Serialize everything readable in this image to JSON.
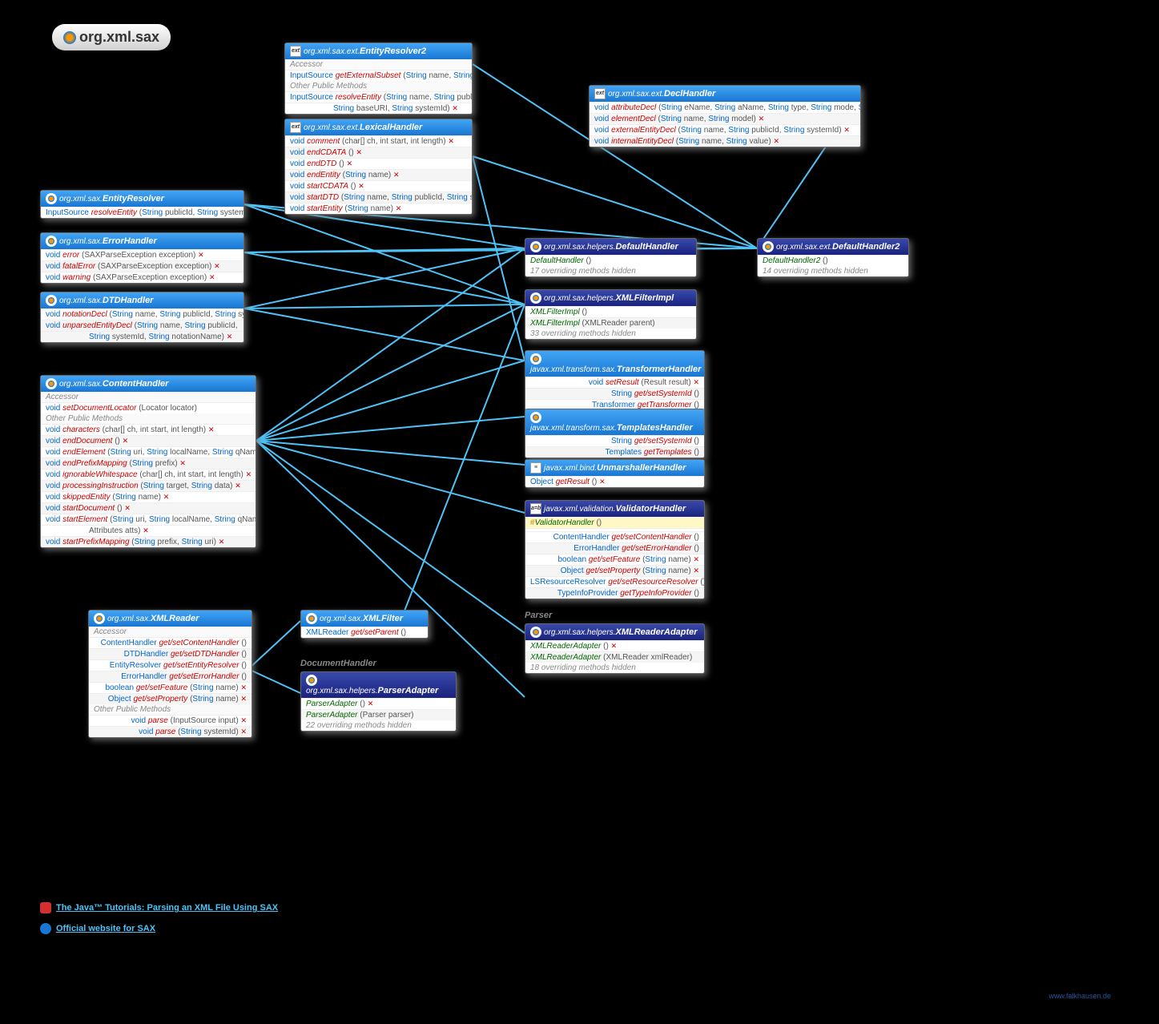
{
  "title": "org.xml.sax",
  "boxes": {
    "entityResolver2": {
      "pkg": "org.xml.sax.ext.",
      "cls": "EntityResolver2",
      "sections": [
        {
          "label": "Accessor",
          "rows": [
            {
              "ret": "InputSource",
              "meth": "getExternalSubset",
              "params": "(String name, String baseURI)",
              "throws": true
            }
          ]
        },
        {
          "label": "Other Public Methods",
          "rows": [
            {
              "ret": "InputSource",
              "meth": "resolveEntity",
              "params": "(String name, String publicId,",
              "cont": "String baseURI, String systemId)",
              "throws": true
            }
          ]
        }
      ]
    },
    "declHandler": {
      "pkg": "org.xml.sax.ext.",
      "cls": "DeclHandler",
      "rows": [
        {
          "ret": "void",
          "meth": "attributeDecl",
          "params": "(String eName, String aName, String type, String mode, String value)",
          "throws": true
        },
        {
          "ret": "void",
          "meth": "elementDecl",
          "params": "(String name, String model)",
          "throws": true
        },
        {
          "ret": "void",
          "meth": "externalEntityDecl",
          "params": "(String name, String publicId, String systemId)",
          "throws": true
        },
        {
          "ret": "void",
          "meth": "internalEntityDecl",
          "params": "(String name, String value)",
          "throws": true
        }
      ]
    },
    "lexicalHandler": {
      "pkg": "org.xml.sax.ext.",
      "cls": "LexicalHandler",
      "rows": [
        {
          "ret": "void",
          "meth": "comment",
          "params": "(char[] ch, int start, int length)",
          "throws": true
        },
        {
          "ret": "void",
          "meth": "endCDATA",
          "params": "()",
          "throws": true
        },
        {
          "ret": "void",
          "meth": "endDTD",
          "params": "()",
          "throws": true
        },
        {
          "ret": "void",
          "meth": "endEntity",
          "params": "(String name)",
          "throws": true
        },
        {
          "ret": "void",
          "meth": "startCDATA",
          "params": "()",
          "throws": true
        },
        {
          "ret": "void",
          "meth": "startDTD",
          "params": "(String name, String publicId, String systemId)",
          "throws": true
        },
        {
          "ret": "void",
          "meth": "startEntity",
          "params": "(String name)",
          "throws": true
        }
      ]
    },
    "entityResolver": {
      "pkg": "org.xml.sax.",
      "cls": "EntityResolver",
      "rows": [
        {
          "ret": "InputSource",
          "meth": "resolveEntity",
          "params": "(String publicId, String systemId)",
          "throws": true
        }
      ]
    },
    "errorHandler": {
      "pkg": "org.xml.sax.",
      "cls": "ErrorHandler",
      "rows": [
        {
          "ret": "void",
          "meth": "error",
          "params": "(SAXParseException exception)",
          "throws": true
        },
        {
          "ret": "void",
          "meth": "fatalError",
          "params": "(SAXParseException exception)",
          "throws": true
        },
        {
          "ret": "void",
          "meth": "warning",
          "params": "(SAXParseException exception)",
          "throws": true
        }
      ]
    },
    "dtdHandler": {
      "pkg": "org.xml.sax.",
      "cls": "DTDHandler",
      "rows": [
        {
          "ret": "void",
          "meth": "notationDecl",
          "params": "(String name, String publicId, String systemId)",
          "throws": true
        },
        {
          "ret": "void",
          "meth": "unparsedEntityDecl",
          "params": "(String name, String publicId,",
          "cont": "String systemId, String notationName)",
          "throws": true
        }
      ]
    },
    "contentHandler": {
      "pkg": "org.xml.sax.",
      "cls": "ContentHandler",
      "sections": [
        {
          "label": "Accessor",
          "rows": [
            {
              "ret": "void",
              "meth": "setDocumentLocator",
              "params": "(Locator locator)"
            }
          ]
        },
        {
          "label": "Other Public Methods",
          "rows": [
            {
              "ret": "void",
              "meth": "characters",
              "params": "(char[] ch, int start, int length)",
              "throws": true
            },
            {
              "ret": "void",
              "meth": "endDocument",
              "params": "()",
              "throws": true
            },
            {
              "ret": "void",
              "meth": "endElement",
              "params": "(String uri, String localName, String qName)",
              "throws": true
            },
            {
              "ret": "void",
              "meth": "endPrefixMapping",
              "params": "(String prefix)",
              "throws": true
            },
            {
              "ret": "void",
              "meth": "ignorableWhitespace",
              "params": "(char[] ch, int start, int length)",
              "throws": true
            },
            {
              "ret": "void",
              "meth": "processingInstruction",
              "params": "(String target, String data)",
              "throws": true
            },
            {
              "ret": "void",
              "meth": "skippedEntity",
              "params": "(String name)",
              "throws": true
            },
            {
              "ret": "void",
              "meth": "startDocument",
              "params": "()",
              "throws": true
            },
            {
              "ret": "void",
              "meth": "startElement",
              "params": "(String uri, String localName, String qName,",
              "cont": "Attributes atts)",
              "throws": true
            },
            {
              "ret": "void",
              "meth": "startPrefixMapping",
              "params": "(String prefix, String uri)",
              "throws": true
            }
          ]
        }
      ]
    },
    "defaultHandler": {
      "pkg": "org.xml.sax.helpers.",
      "cls": "DefaultHandler",
      "rows": [
        {
          "ctor": "DefaultHandler",
          "params": "()"
        }
      ],
      "note": "17 overriding methods hidden"
    },
    "defaultHandler2": {
      "pkg": "org.xml.sax.ext.",
      "cls": "DefaultHandler2",
      "rows": [
        {
          "ctor": "DefaultHandler2",
          "params": "()"
        }
      ],
      "note": "14 overriding methods hidden"
    },
    "xmlFilterImpl": {
      "pkg": "org.xml.sax.helpers.",
      "cls": "XMLFilterImpl",
      "rows": [
        {
          "ctor": "XMLFilterImpl",
          "params": "()"
        },
        {
          "ctor": "XMLFilterImpl",
          "params": "(XMLReader parent)"
        }
      ],
      "note": "33 overriding methods hidden"
    },
    "transformerHandler": {
      "pkg": "javax.xml.transform.sax.",
      "cls": "TransformerHandler",
      "rows": [
        {
          "ret": "void",
          "meth": "setResult",
          "params": "(Result result)",
          "throws": true
        },
        {
          "ret": "String",
          "meth": "get/setSystemId",
          "params": "()"
        },
        {
          "ret": "Transformer",
          "meth": "getTransformer",
          "params": "()"
        }
      ]
    },
    "templatesHandler": {
      "pkg": "javax.xml.transform.sax.",
      "cls": "TemplatesHandler",
      "rows": [
        {
          "ret": "String",
          "meth": "get/setSystemId",
          "params": "()"
        },
        {
          "ret": "Templates",
          "meth": "getTemplates",
          "params": "()"
        }
      ]
    },
    "unmarshallerHandler": {
      "pkg": "javax.xml.bind.",
      "cls": "UnmarshallerHandler",
      "rows": [
        {
          "ret": "Object",
          "meth": "getResult",
          "params": "()",
          "throws": true
        }
      ]
    },
    "validatorHandler": {
      "pkg": "javax.xml.validation.",
      "cls": "ValidatorHandler",
      "rows": [
        {
          "prot": true,
          "ctor": "ValidatorHandler",
          "params": "()"
        },
        {
          "sep": true
        },
        {
          "ret": "ContentHandler",
          "meth": "get/setContentHandler",
          "params": "()"
        },
        {
          "ret": "ErrorHandler",
          "meth": "get/setErrorHandler",
          "params": "()"
        },
        {
          "ret": "boolean",
          "meth": "get/setFeature",
          "params": "(String name)",
          "throws": true
        },
        {
          "ret": "Object",
          "meth": "get/setProperty",
          "params": "(String name)",
          "throws": true
        },
        {
          "ret": "LSResourceResolver",
          "meth": "get/setResourceResolver",
          "params": "()"
        },
        {
          "ret": "TypeInfoProvider",
          "meth": "getTypeInfoProvider",
          "params": "()"
        }
      ]
    },
    "xmlReader": {
      "pkg": "org.xml.sax.",
      "cls": "XMLReader",
      "sections": [
        {
          "label": "Accessor",
          "rows": [
            {
              "ret": "ContentHandler",
              "meth": "get/setContentHandler",
              "params": "()"
            },
            {
              "ret": "DTDHandler",
              "meth": "get/setDTDHandler",
              "params": "()"
            },
            {
              "ret": "EntityResolver",
              "meth": "get/setEntityResolver",
              "params": "()"
            },
            {
              "ret": "ErrorHandler",
              "meth": "get/setErrorHandler",
              "params": "()"
            },
            {
              "ret": "boolean",
              "meth": "get/setFeature",
              "params": "(String name)",
              "throws": true
            },
            {
              "ret": "Object",
              "meth": "get/setProperty",
              "params": "(String name)",
              "throws": true
            }
          ]
        },
        {
          "label": "Other Public Methods",
          "rows": [
            {
              "ret": "void",
              "meth": "parse",
              "params": "(InputSource input)",
              "throws": true
            },
            {
              "ret": "void",
              "meth": "parse",
              "params": "(String systemId)",
              "throws": true
            }
          ]
        }
      ]
    },
    "xmlFilter": {
      "pkg": "org.xml.sax.",
      "cls": "XMLFilter",
      "rows": [
        {
          "ret": "XMLReader",
          "meth": "get/setParent",
          "params": "()"
        }
      ]
    },
    "parserAdapter": {
      "pkg": "org.xml.sax.helpers.",
      "cls": "ParserAdapter",
      "rows": [
        {
          "ctor": "ParserAdapter",
          "params": "()",
          "throws": true
        },
        {
          "ctor": "ParserAdapter",
          "params": "(Parser parser)"
        }
      ],
      "note": "22 overriding methods hidden"
    },
    "xmlReaderAdapter": {
      "pkg": "org.xml.sax.helpers.",
      "cls": "XMLReaderAdapter",
      "rows": [
        {
          "ctor": "XMLReaderAdapter",
          "params": "()",
          "throws": true
        },
        {
          "ctor": "XMLReaderAdapter",
          "params": "(XMLReader xmlReader)"
        }
      ],
      "note": "18 overriding methods hidden"
    }
  },
  "labels": {
    "documentHandler": "DocumentHandler",
    "parser": "Parser"
  },
  "links": {
    "tutorial": "The Java™ Tutorials: Parsing an XML File Using SAX",
    "official": "Official website for SAX"
  },
  "footer": "www.falkhausen.de"
}
